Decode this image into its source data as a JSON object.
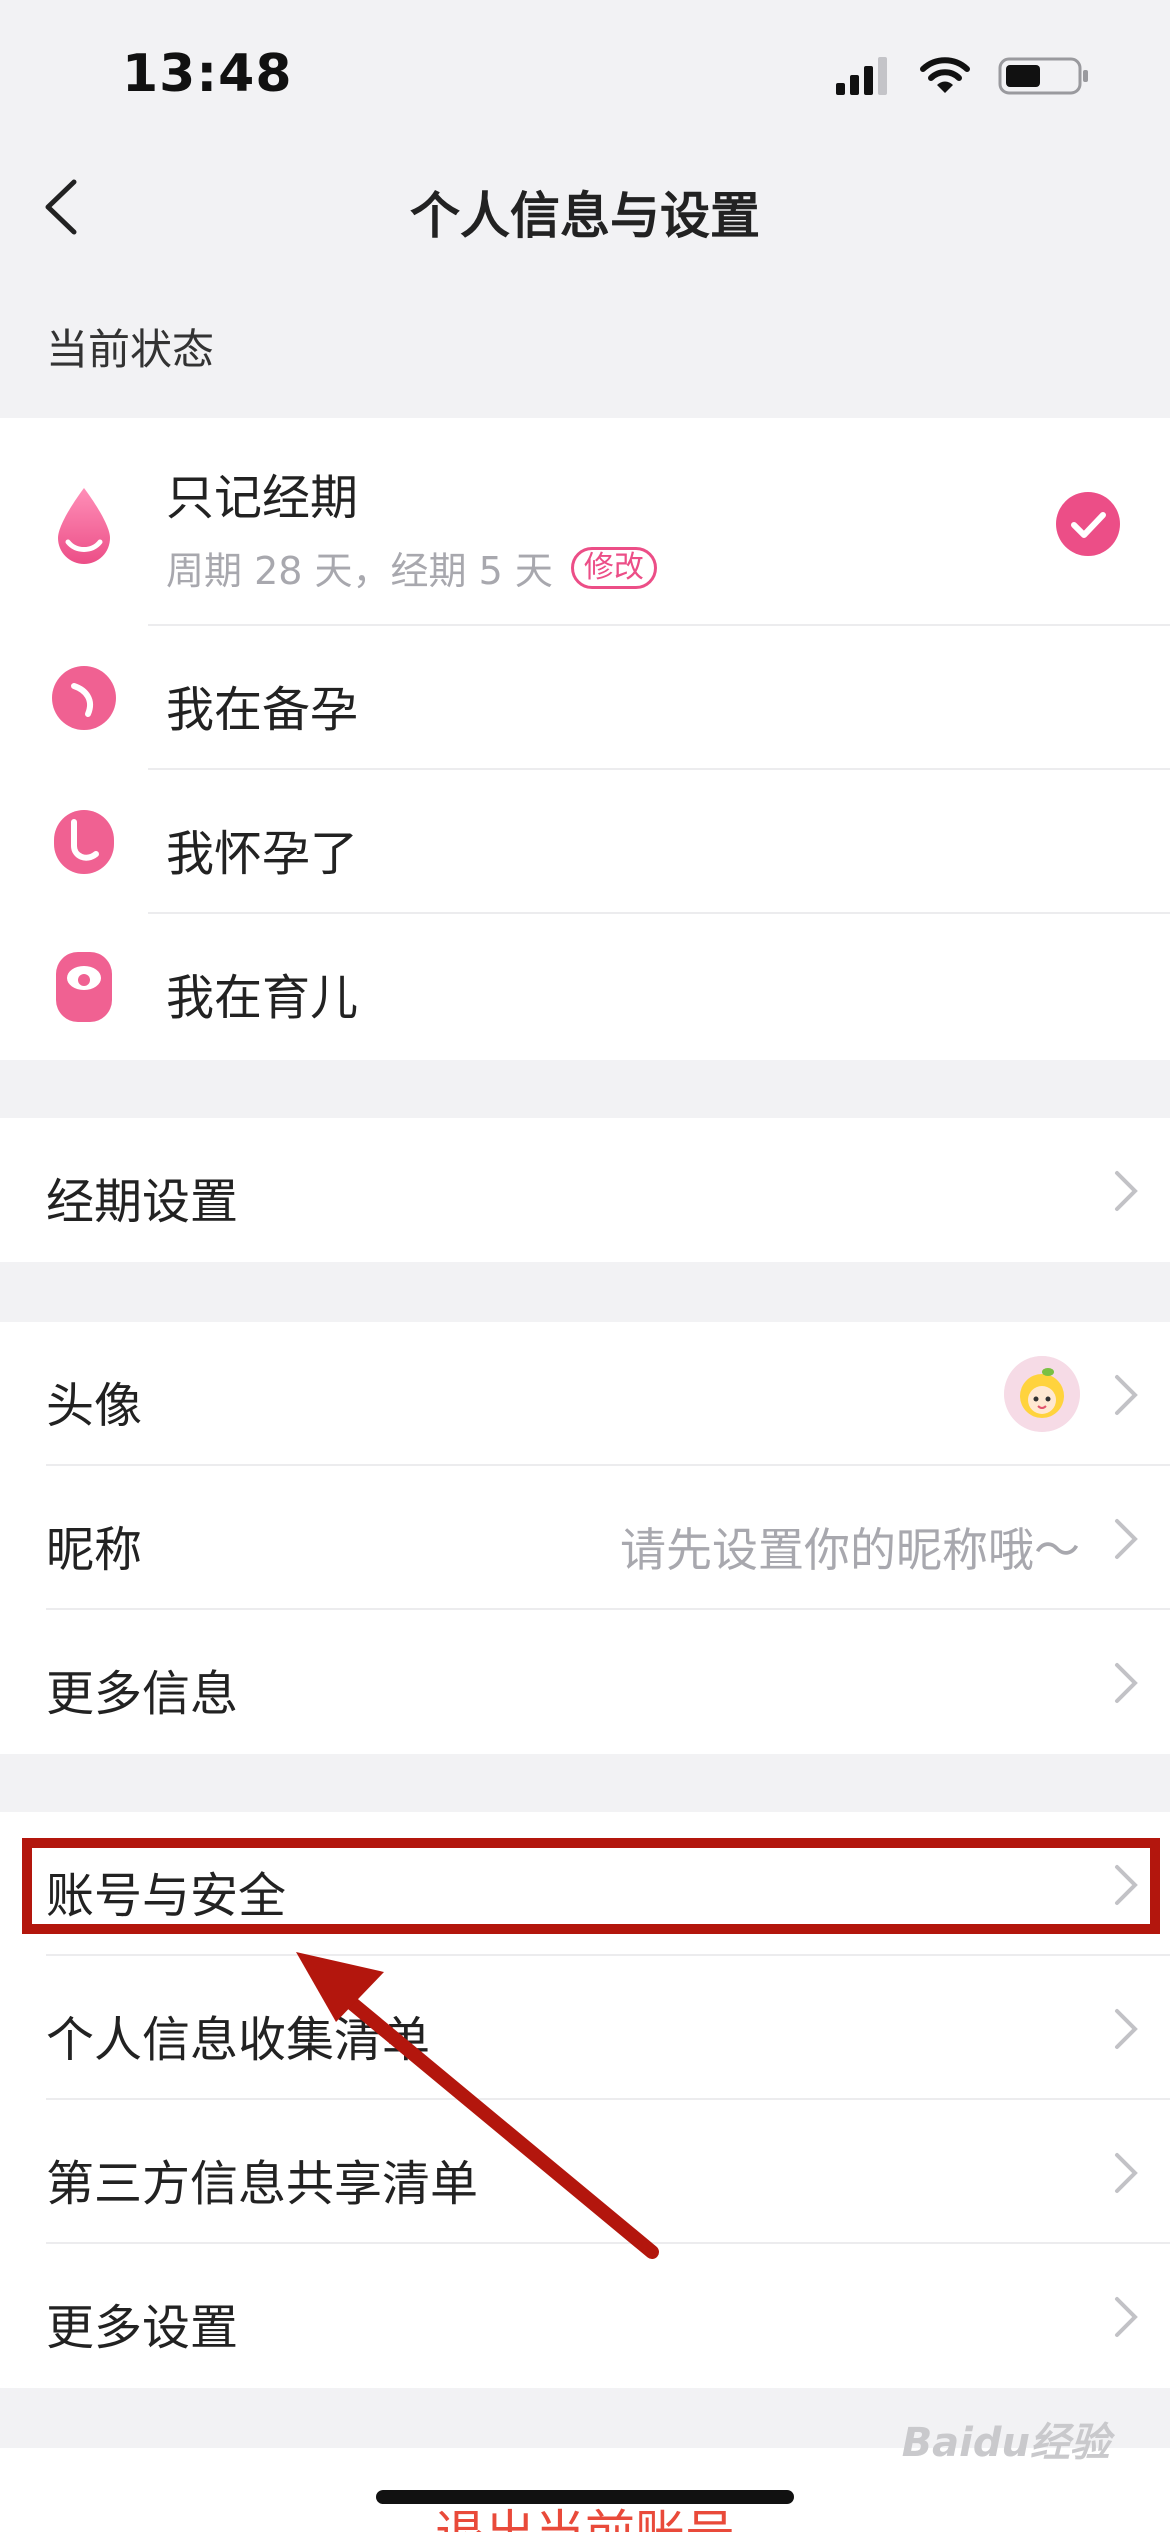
{
  "status_bar": {
    "time": "13:48"
  },
  "nav": {
    "title": "个人信息与设置"
  },
  "current_status": {
    "section_label": "当前状态",
    "items": [
      {
        "label": "只记经期",
        "sub": "周期 28 天，经期 5 天",
        "tag": "修改",
        "selected": true,
        "icon": "drop-icon"
      },
      {
        "label": "我在备孕",
        "icon": "prep-pregnancy-icon"
      },
      {
        "label": "我怀孕了",
        "icon": "pregnant-icon"
      },
      {
        "label": "我在育儿",
        "icon": "baby-icon"
      }
    ]
  },
  "period_group": {
    "items": [
      {
        "label": "经期设置"
      }
    ]
  },
  "profile_group": {
    "items": [
      {
        "label": "头像"
      },
      {
        "label": "昵称",
        "value": "请先设置你的昵称哦～"
      },
      {
        "label": "更多信息"
      }
    ]
  },
  "account_group": {
    "items": [
      {
        "label": "账号与安全"
      },
      {
        "label": "个人信息收集清单"
      },
      {
        "label": "第三方信息共享清单"
      },
      {
        "label": "更多设置"
      }
    ]
  },
  "logout": {
    "label": "退出当前账号"
  },
  "watermark": "Baidu经验",
  "colors": {
    "accent": "#ec4e87",
    "highlight": "#b3160d",
    "logout": "#e94a3a"
  }
}
